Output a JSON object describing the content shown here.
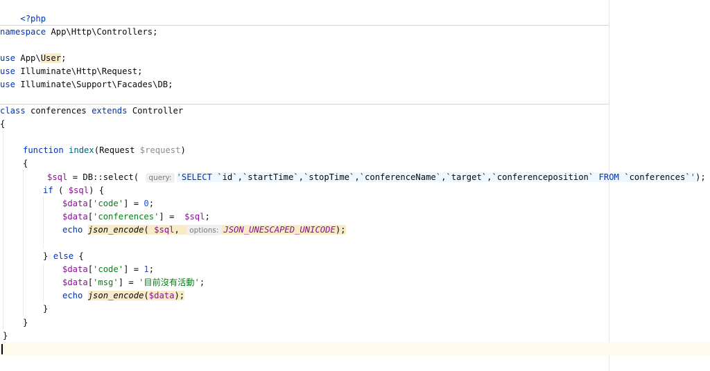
{
  "code": {
    "php_open": "<?php",
    "ns_keyword": "namespace",
    "ns_path": "App\\Http\\Controllers;",
    "use_keyword": "use",
    "use1_prefix": "App\\",
    "use1_class": "User",
    "use1_suffix": ";",
    "use2": "Illuminate\\Http\\Request;",
    "use3": "Illuminate\\Support\\Facades\\DB;",
    "class_keyword": "class",
    "class_name": "conferences",
    "extends_keyword": "extends",
    "parent_class": "Controller",
    "open_brace": "{",
    "close_brace": "}",
    "function_keyword": "function",
    "function_name": "index",
    "param_type": "(Request ",
    "param_var": "$request",
    "param_close": ")",
    "sql_var": "$sql",
    "db_call": " = DB::select( ",
    "hint_query": "query:",
    "sql_quote_open": "'",
    "sql_select": "SELECT",
    "sql_columns": " `id`,`startTime`,`stopTime`,`conferenceName`,`target`,`conferenceposition` ",
    "sql_from": "FROM",
    "sql_table": " `conferences`",
    "sql_quote_close": "'",
    "sql_end": ");",
    "if_keyword": "if",
    "if_open": " ( ",
    "if_close": ") {",
    "data_var": "$data",
    "key_code": "'code'",
    "assign_code_0": "] = ",
    "num_0": "0",
    "num_1": "1",
    "semicolon": ";",
    "open_bracket": "[",
    "key_conferences": "'conferences'",
    "assign_conferences": "] =  ",
    "echo_keyword": "echo",
    "json_encode_fn": "json_encode",
    "paren_open": "( ",
    "paren_plain_open": "(",
    "comma": ",",
    "hint_options": "options:",
    "json_const": "JSON_UNESCAPED_UNICODE",
    "paren_close_semi": ");",
    "else_close": "} ",
    "else_keyword": "else",
    "else_open": " {",
    "key_msg": "'msg'",
    "assign_eq": "] = ",
    "msg_string": "'目前沒有活動'"
  },
  "colors": {
    "keyword": "#0033b3",
    "function": "#00627a",
    "variable": "#871094",
    "string": "#067d17",
    "number": "#1750eb",
    "highlight": "#f8ecc8",
    "current_line": "#fefbed"
  }
}
